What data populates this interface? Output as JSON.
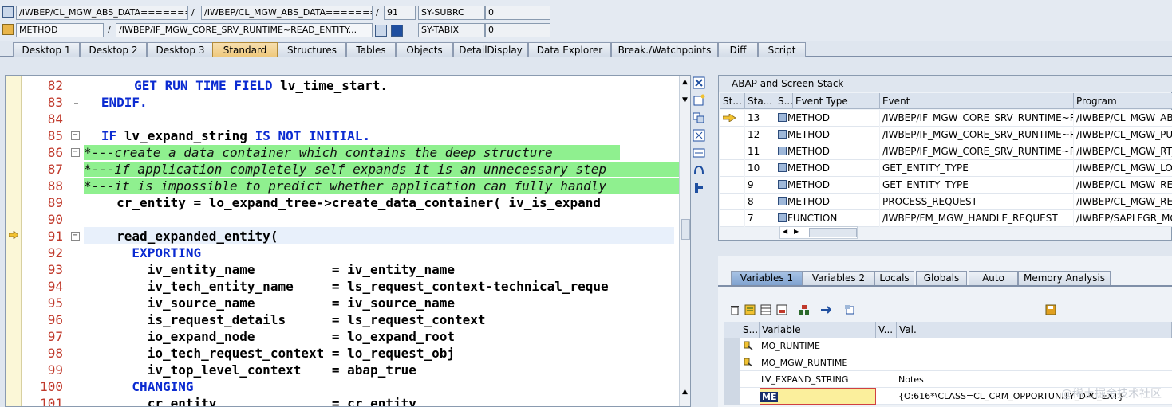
{
  "topbar": {
    "row1": {
      "field1": "/IWBEP/CL_MGW_ABS_DATA=======",
      "sep1": "/",
      "field2": "/IWBEP/CL_MGW_ABS_DATA=======",
      "sep2": "/",
      "line_no": "91",
      "sysvar": "SY-SUBRC",
      "sysval": "0"
    },
    "row2": {
      "field1": "METHOD",
      "sep1": "/",
      "field2": "/IWBEP/IF_MGW_CORE_SRV_RUNTIME~READ_ENTITY...",
      "sysvar": "SY-TABIX",
      "sysval": "0"
    }
  },
  "tabs": [
    "Desktop 1",
    "Desktop 2",
    "Desktop 3",
    "Standard",
    "Structures",
    "Tables",
    "Objects",
    "DetailDisplay",
    "Data Explorer",
    "Break./Watchpoints",
    "Diff",
    "Script"
  ],
  "active_tab": "Standard",
  "code": {
    "lines": [
      {
        "n": "82",
        "text": "  GET RUN TIME FIELD lv_time_start."
      },
      {
        "n": "83",
        "text": "ENDIF."
      },
      {
        "n": "84",
        "text": ""
      },
      {
        "n": "85",
        "text": "IF lv_expand_string IS NOT INITIAL."
      },
      {
        "n": "86",
        "text": "*---create a data container which contains the deep structure"
      },
      {
        "n": "87",
        "text": "*---if application completely self expands it is an unnecessary step"
      },
      {
        "n": "88",
        "text": "*---it is impossible to predict whether application can fully handly"
      },
      {
        "n": "89",
        "text": "  cr_entity = lo_expand_tree->create_data_container( iv_is_expand"
      },
      {
        "n": "90",
        "text": ""
      },
      {
        "n": "91",
        "text": "  read_expanded_entity("
      },
      {
        "n": "92",
        "text": "    EXPORTING"
      },
      {
        "n": "93",
        "text": "      iv_entity_name          = iv_entity_name"
      },
      {
        "n": "94",
        "text": "      iv_tech_entity_name     = ls_request_context-technical_reque"
      },
      {
        "n": "95",
        "text": "      iv_source_name          = iv_source_name"
      },
      {
        "n": "96",
        "text": "      is_request_details      = ls_request_context"
      },
      {
        "n": "97",
        "text": "      io_expand_node          = lo_expand_root"
      },
      {
        "n": "98",
        "text": "      io_tech_request_context = lo_request_obj"
      },
      {
        "n": "99",
        "text": "      iv_top_level_context    = abap_true"
      },
      {
        "n": "100",
        "text": "    CHANGING"
      },
      {
        "n": "101",
        "text": "      cr_entity               = cr_entity"
      }
    ]
  },
  "stack": {
    "title": "ABAP and Screen Stack",
    "columns": [
      "St...",
      "Sta...",
      "S...",
      "Event Type",
      "Event",
      "Program"
    ],
    "rows": [
      {
        "level": "13",
        "type": "METHOD",
        "event": "/IWBEP/IF_MGW_CORE_SRV_RUNTIME~R...",
        "program": "/IWBEP/CL_MGW_ABS",
        "current": true
      },
      {
        "level": "12",
        "type": "METHOD",
        "event": "/IWBEP/IF_MGW_CORE_SRV_RUNTIME~R...",
        "program": "/IWBEP/CL_MGW_PUS",
        "current": false
      },
      {
        "level": "11",
        "type": "METHOD",
        "event": "/IWBEP/IF_MGW_CORE_SRV_RUNTIME~R...",
        "program": "/IWBEP/CL_MGW_RT_",
        "current": false
      },
      {
        "level": "10",
        "type": "METHOD",
        "event": "GET_ENTITY_TYPE",
        "program": "/IWBEP/CL_MGW_LOC",
        "current": false
      },
      {
        "level": "9",
        "type": "METHOD",
        "event": "GET_ENTITY_TYPE",
        "program": "/IWBEP/CL_MGW_REM",
        "current": false
      },
      {
        "level": "8",
        "type": "METHOD",
        "event": "PROCESS_REQUEST",
        "program": "/IWBEP/CL_MGW_REM",
        "current": false
      },
      {
        "level": "7",
        "type": "FUNCTION",
        "event": "/IWBEP/FM_MGW_HANDLE_REQUEST",
        "program": "/IWBEP/SAPLFGR_MGW",
        "current": false
      }
    ]
  },
  "variables": {
    "tabs": [
      "Variables 1",
      "Variables 2",
      "Locals",
      "Globals",
      "Auto",
      "Memory Analysis"
    ],
    "active_tab": "Variables 1",
    "columns": [
      "S...",
      "Variable",
      "V...",
      "Val."
    ],
    "rows": [
      {
        "name": "MO_RUNTIME",
        "value": ""
      },
      {
        "name": "MO_MGW_RUNTIME",
        "value": ""
      },
      {
        "name": "LV_EXPAND_STRING",
        "value": "Notes"
      },
      {
        "name": "ME",
        "value": "{O:616*\\CLASS=CL_CRM_OPPORTUNITY_DPC_EXT}"
      }
    ]
  },
  "watermark": "@稀土掘金技术社区",
  "colors": {
    "comment_bg": "#8ff08f",
    "keyword": "#0b2bd1",
    "line_number": "#c0392b",
    "active_tab": "#eec77a"
  }
}
